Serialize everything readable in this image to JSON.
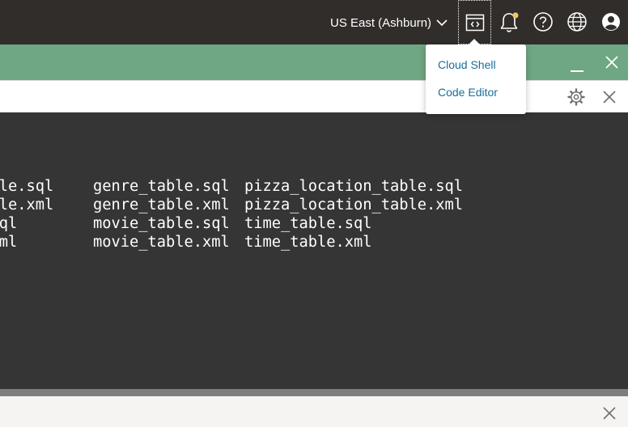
{
  "header": {
    "region_label": "US East (Ashburn)",
    "colors": {
      "bar": "#312d2a",
      "icon": "#ffffff",
      "notification_dot": "#f4c25b"
    },
    "icons": [
      "developer-tools-icon",
      "bell-icon",
      "help-icon",
      "globe-icon",
      "profile-icon"
    ]
  },
  "dev_tools_menu": {
    "items": [
      {
        "label": "Cloud Shell"
      },
      {
        "label": "Code Editor"
      }
    ],
    "link_color": "#1a6e9a"
  },
  "cloud_shell": {
    "header_color": "#6fa683",
    "terminal_background": "#353535",
    "terminal_lines": [
      {
        "col1": "table.sql",
        "col2": "genre_table.sql",
        "col3": "pizza_location_table.sql"
      },
      {
        "col1": "table.xml",
        "col2": "genre_table.xml",
        "col3": "pizza_location_table.xml"
      },
      {
        "col1": "e.sql",
        "col2": "movie_table.sql",
        "col3": "time_table.sql"
      },
      {
        "col1": "e.xml",
        "col2": "movie_table.xml",
        "col3": "time_table.xml"
      }
    ]
  }
}
